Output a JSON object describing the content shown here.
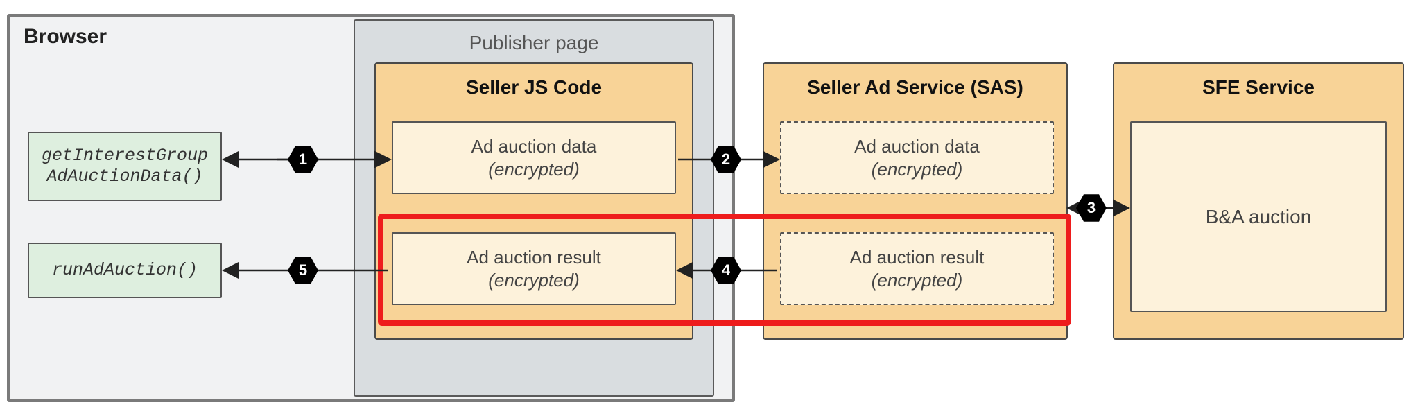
{
  "browser_title": "Browser",
  "publisher_title": "Publisher page",
  "seller_js_title": "Seller JS Code",
  "sas_title": "Seller Ad Service (SAS)",
  "sfe_title": "SFE Service",
  "code_boxes": {
    "get_igad": "getInterestGroup\nAdAuctionData()",
    "run_auction": "runAdAuction()"
  },
  "data_boxes": {
    "ad_auction_data": "Ad auction data",
    "ad_auction_result": "Ad auction result",
    "encrypted": "(encrypted)",
    "ba_auction": "B&A auction"
  },
  "steps": {
    "s1": "1",
    "s2": "2",
    "s3": "3",
    "s4": "4",
    "s5": "5"
  }
}
